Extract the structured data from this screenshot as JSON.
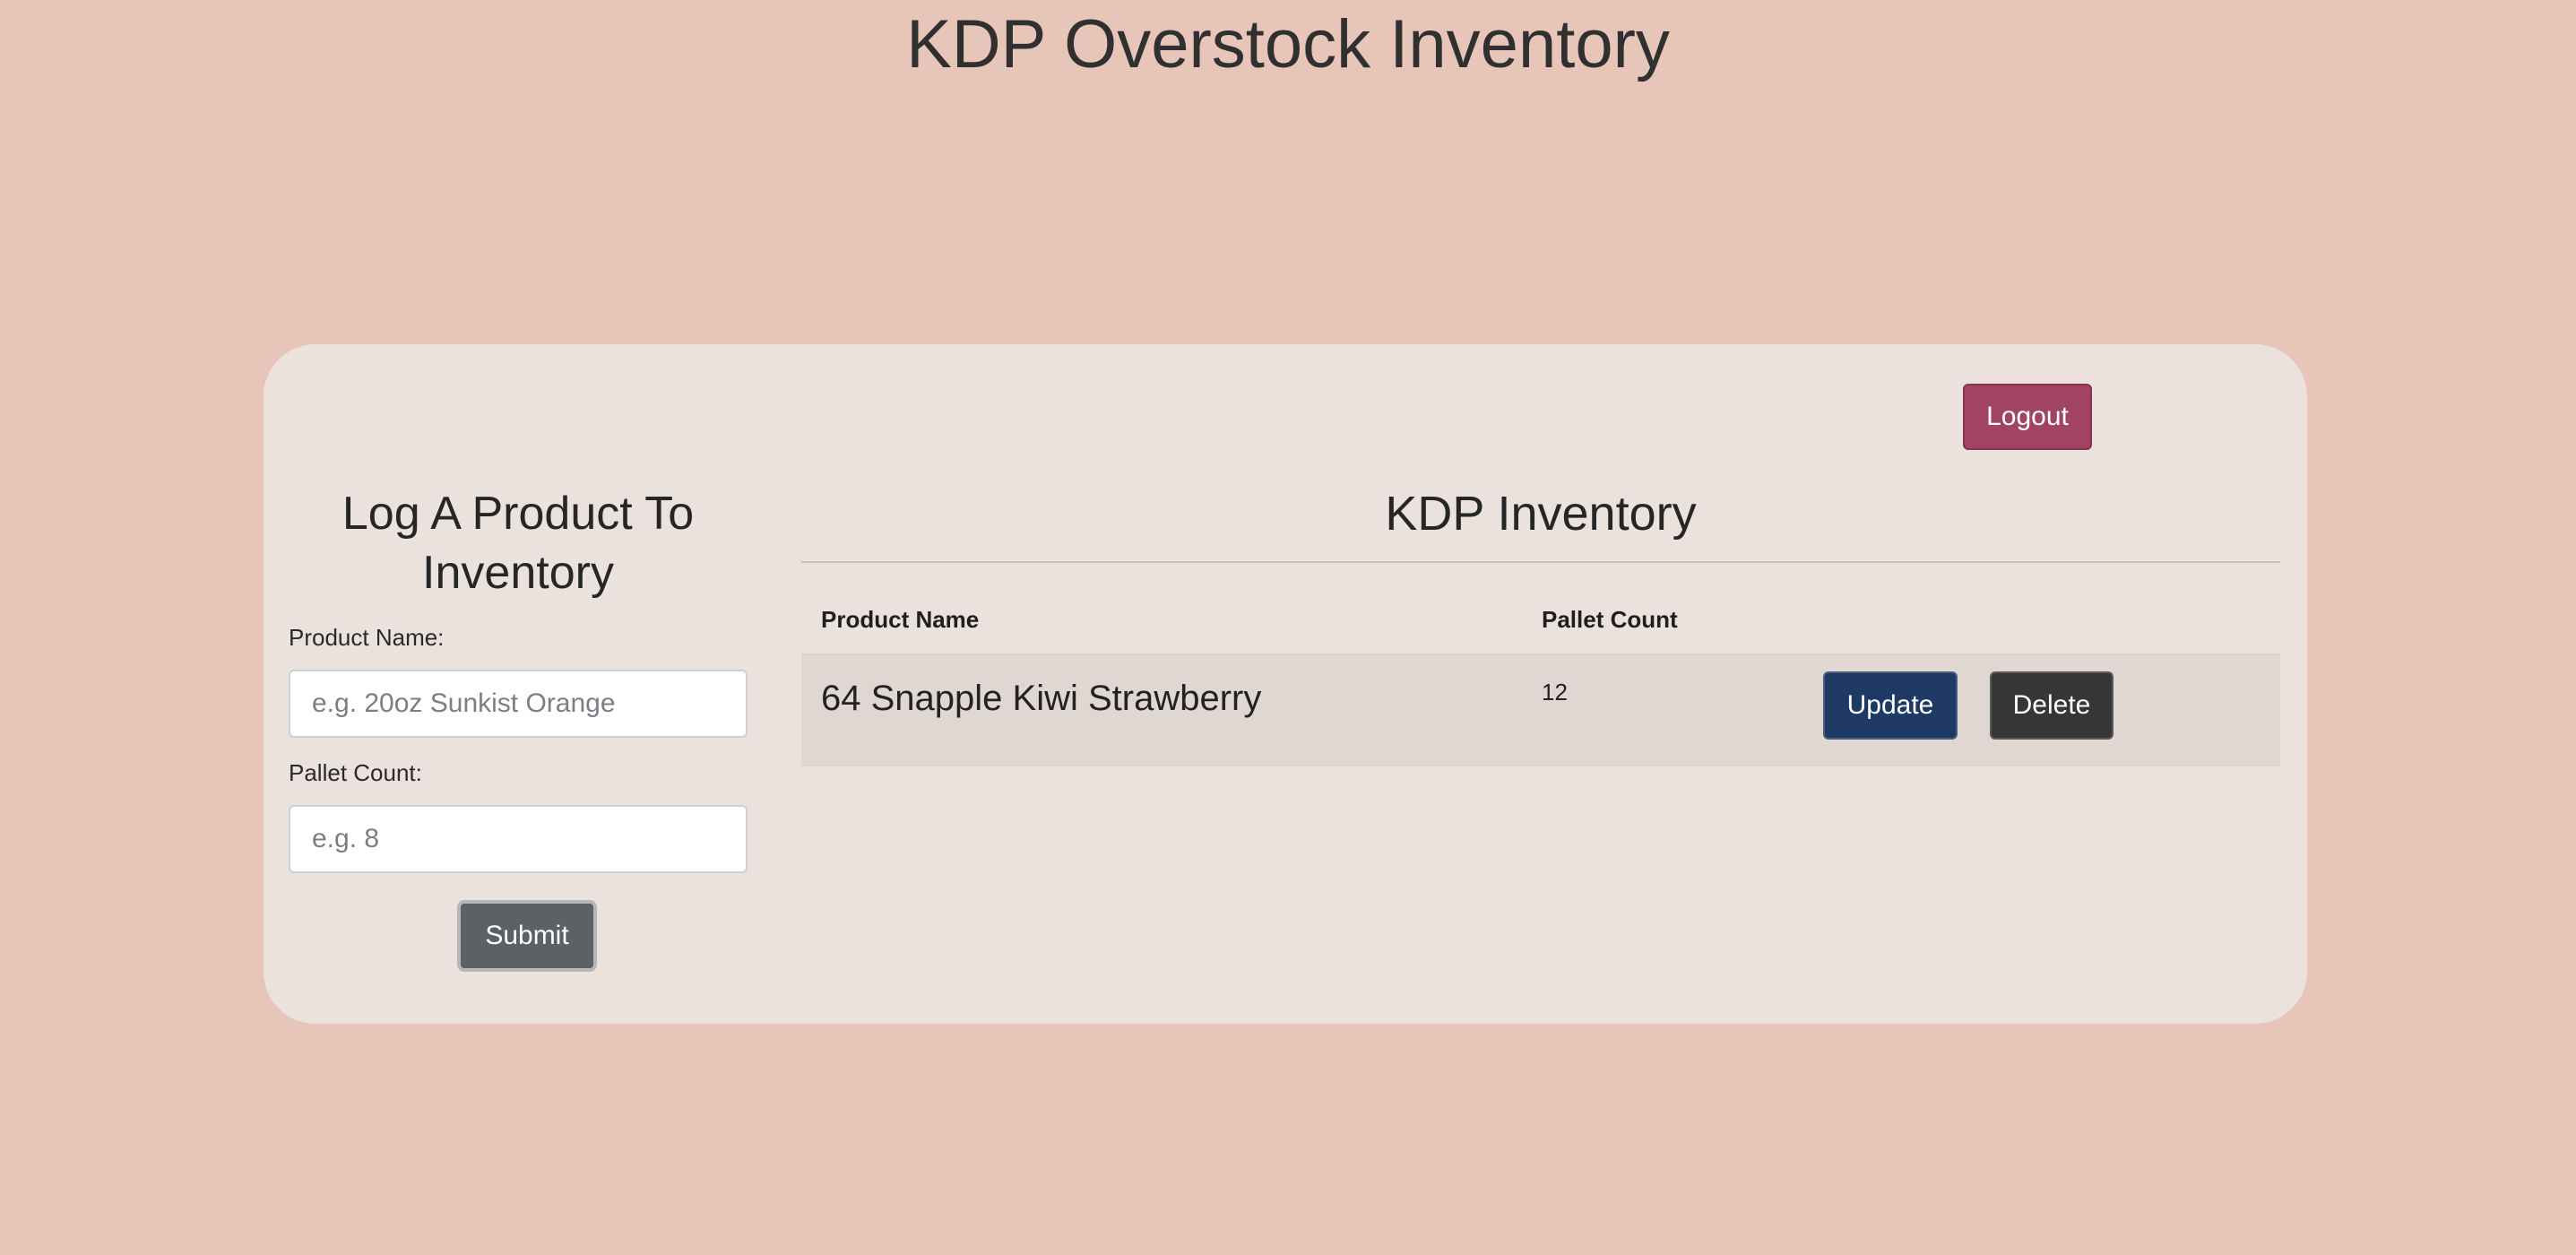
{
  "header": {
    "title": "KDP Overstock Inventory"
  },
  "card": {
    "logout_label": "Logout"
  },
  "form": {
    "title": "Log A Product To Inventory",
    "product_name_label": "Product Name:",
    "product_name_placeholder": "e.g. 20oz Sunkist Orange",
    "product_name_value": "",
    "pallet_count_label": "Pallet Count:",
    "pallet_count_placeholder": "e.g. 8",
    "pallet_count_value": "",
    "submit_label": "Submit"
  },
  "inventory": {
    "title": "KDP Inventory",
    "columns": [
      "Product Name",
      "Pallet Count",
      ""
    ],
    "rows": [
      {
        "product_name": "64 Snapple Kiwi Strawberry",
        "pallet_count": "12",
        "update_label": "Update",
        "delete_label": "Delete"
      }
    ]
  },
  "colors": {
    "background": "#e7c6b9",
    "card": "#ebe1dd",
    "logout": "#a04461",
    "update": "#1e3a64",
    "delete": "#363636",
    "submit": "#5d6166"
  }
}
